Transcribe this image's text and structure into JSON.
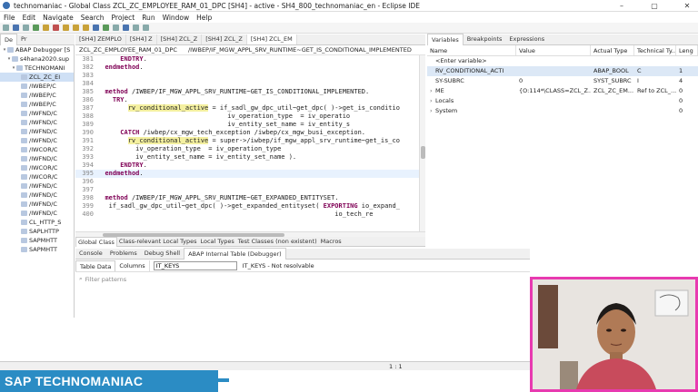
{
  "window": {
    "title": "technomaniac - Global Class ZCL_ZC_EMPLOYEE_RAM_01_DPC [SH4] - active - SH4_800_technomaniac_en - Eclipse IDE",
    "minimize": "–",
    "maximize": "▢",
    "close": "✕"
  },
  "menu": [
    "File",
    "Edit",
    "Navigate",
    "Search",
    "Project",
    "Run",
    "Window",
    "Help"
  ],
  "left_view_tabs": [
    "De",
    "Pr"
  ],
  "tree": [
    {
      "label": "ABAP Debugger [S",
      "indent": 0,
      "twisty": "▾"
    },
    {
      "label": "s4hana2020.sup",
      "indent": 1,
      "twisty": "▾"
    },
    {
      "label": "TECHNOMANI",
      "indent": 2,
      "twisty": "▾"
    },
    {
      "label": "ZCL_ZC_EI",
      "indent": 3,
      "twisty": "",
      "selected": true
    },
    {
      "label": "/IWBEP/C",
      "indent": 3,
      "twisty": ""
    },
    {
      "label": "/IWBEP/C",
      "indent": 3,
      "twisty": ""
    },
    {
      "label": "/IWBEP/C",
      "indent": 3,
      "twisty": ""
    },
    {
      "label": "/IWFND/C",
      "indent": 3,
      "twisty": ""
    },
    {
      "label": "/IWFND/C",
      "indent": 3,
      "twisty": ""
    },
    {
      "label": "/IWFND/C",
      "indent": 3,
      "twisty": ""
    },
    {
      "label": "/IWFND/C",
      "indent": 3,
      "twisty": ""
    },
    {
      "label": "/IWCOR/C",
      "indent": 3,
      "twisty": ""
    },
    {
      "label": "/IWFND/C",
      "indent": 3,
      "twisty": ""
    },
    {
      "label": "/IWCOR/C",
      "indent": 3,
      "twisty": ""
    },
    {
      "label": "/IWCOR/C",
      "indent": 3,
      "twisty": ""
    },
    {
      "label": "/IWFND/C",
      "indent": 3,
      "twisty": ""
    },
    {
      "label": "/IWFND/C",
      "indent": 3,
      "twisty": ""
    },
    {
      "label": "/IWFND/C",
      "indent": 3,
      "twisty": ""
    },
    {
      "label": "/IWFND/C",
      "indent": 3,
      "twisty": ""
    },
    {
      "label": "CL_HTTP_S",
      "indent": 3,
      "twisty": ""
    },
    {
      "label": "SAPLHTTP",
      "indent": 3,
      "twisty": ""
    },
    {
      "label": "SAPMHTT",
      "indent": 3,
      "twisty": ""
    },
    {
      "label": "SAPMHTT",
      "indent": 3,
      "twisty": ""
    }
  ],
  "editor_tabs": [
    {
      "label": "[SH4] ZEMPLO",
      "active": false
    },
    {
      "label": "[SH4] Z",
      "active": false
    },
    {
      "label": "[SH4] ZCL_Z",
      "active": false
    },
    {
      "label": "[SH4] ZCL_Z",
      "active": false
    },
    {
      "label": "[SH4] ZCL_EM",
      "active": true
    }
  ],
  "breadcrumb": {
    "class": "ZCL_ZC_EMPLOYEE_RAM_01_DPC",
    "method": "/IWBEP/IF_MGW_APPL_SRV_RUNTIME~GET_IS_CONDITIONAL_IMPLEMENTED"
  },
  "code_lines": [
    {
      "n": "381",
      "text": "      ENDTRY."
    },
    {
      "n": "382",
      "text": "  endmethod."
    },
    {
      "n": "383",
      "text": ""
    },
    {
      "n": "384",
      "text": ""
    },
    {
      "n": "385",
      "text": "  method /IWBEP/IF_MGW_APPL_SRV_RUNTIME~GET_IS_CONDITIONAL_IMPLEMENTED."
    },
    {
      "n": "386",
      "text": "    TRY."
    },
    {
      "n": "387",
      "text": "        rv_conditional_active = if_sadl_gw_dpc_util~get_dpc( )->get_is_conditio"
    },
    {
      "n": "388",
      "text": "                                  iv_operation_type  = iv_operatio"
    },
    {
      "n": "389",
      "text": "                                  iv_entity_set_name = iv_entity_s"
    },
    {
      "n": "390",
      "text": "      CATCH /iwbep/cx_mgw_tech_exception /iwbep/cx_mgw_busi_exception."
    },
    {
      "n": "391",
      "text": "        rv_conditional_active = super->/iwbep/if_mgw_appl_srv_runtime~get_is_co"
    },
    {
      "n": "392",
      "text": "          iv_operation_type  = iv_operation_type"
    },
    {
      "n": "393",
      "text": "          iv_entity_set_name = iv_entity_set_name )."
    },
    {
      "n": "394",
      "text": "      ENDTRY."
    },
    {
      "n": "395",
      "text": "  endmethod.",
      "current": true
    },
    {
      "n": "396",
      "text": ""
    },
    {
      "n": "397",
      "text": ""
    },
    {
      "n": "398",
      "text": "  method /IWBEP/IF_MGW_APPL_SRV_RUNTIME~GET_EXPANDED_ENTITYSET."
    },
    {
      "n": "399",
      "text": "   if_sadl_gw_dpc_util~get_dpc( )->get_expanded_entityset( EXPORTING io_expand_"
    },
    {
      "n": "400",
      "text": "                                                              io_tech_re"
    }
  ],
  "bottom_editor_tabs": [
    "Global Class",
    "Class-relevant Local Types",
    "Local Types",
    "Test Classes (non existent)",
    "Macros"
  ],
  "variables_view": {
    "tabs": [
      {
        "label": "Variables",
        "active": true
      },
      {
        "label": "Breakpoints",
        "active": false
      },
      {
        "label": "Expressions",
        "active": false
      }
    ],
    "columns": [
      "Name",
      "Value",
      "Actual Type",
      "Technical Ty...",
      "Leng"
    ],
    "rows": [
      {
        "name": "<Enter variable>",
        "value": "",
        "actual": "",
        "tech": "",
        "len": "",
        "twisty": ""
      },
      {
        "name": "RV_CONDITIONAL_ACTI",
        "value": "",
        "actual": "ABAP_BOOL",
        "tech": "C",
        "len": "1",
        "twisty": "",
        "selected": true
      },
      {
        "name": "SY-SUBRC",
        "value": "0",
        "actual": "SYST_SUBRC",
        "tech": "I",
        "len": "4",
        "twisty": ""
      },
      {
        "name": "ME",
        "value": "{O:114*\\CLASS=ZCL_Z...",
        "actual": "ZCL_ZC_EM...",
        "tech": "Ref to ZCL_...",
        "len": "0",
        "twisty": "›"
      },
      {
        "name": "Locals",
        "value": "",
        "actual": "",
        "tech": "",
        "len": "0",
        "twisty": "›"
      },
      {
        "name": "System",
        "value": "",
        "actual": "",
        "tech": "",
        "len": "0",
        "twisty": "›"
      }
    ]
  },
  "console_tabs": [
    {
      "label": "Console",
      "active": false
    },
    {
      "label": "Problems",
      "active": false
    },
    {
      "label": "Debug Shell",
      "active": false
    },
    {
      "label": "ABAP Internal Table (Debugger)",
      "active": true
    }
  ],
  "internal_table": {
    "sub_tabs": [
      "Table Data",
      "Columns"
    ],
    "input_value": "IT_KEYS",
    "status_text": "IT_KEYS - Not resolvable",
    "filter_placeholder": "Filter patterns"
  },
  "status_bar": {
    "position": "1 : 1"
  },
  "banner": {
    "text": "SAP TECHNOMANIAC"
  },
  "colors": {
    "banner": "#2b8cc4",
    "webcam_border": "#e83ab0",
    "keyword": "#7f0055",
    "highlight": "#f4f0a0"
  }
}
